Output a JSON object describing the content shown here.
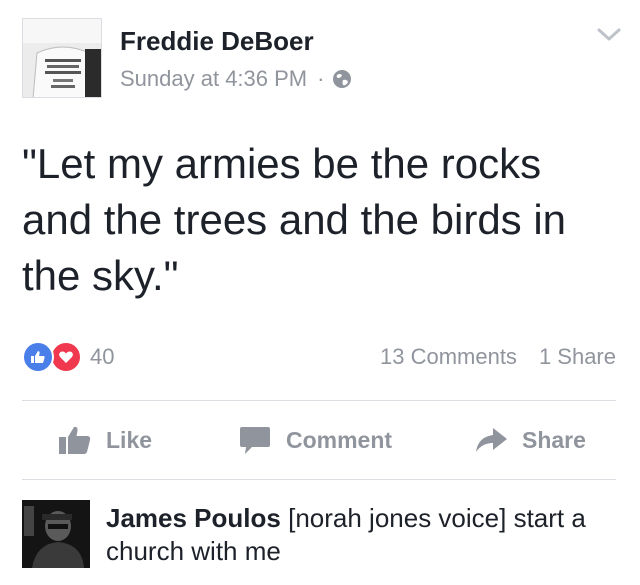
{
  "post": {
    "author": "Freddie DeBoer",
    "timestamp": "Sunday at 4:36 PM",
    "separator": "·",
    "privacy_icon": "globe-icon",
    "options_icon": "chevron-down-icon",
    "text": "\"Let my armies be the rocks and the trees and the birds in the sky.\""
  },
  "stats": {
    "reaction_icons": [
      "like-reaction-icon",
      "love-reaction-icon"
    ],
    "reaction_count": "40",
    "comments": "13 Comments",
    "shares": "1 Share"
  },
  "actions": {
    "like": "Like",
    "comment": "Comment",
    "share": "Share"
  },
  "comment": {
    "author": "James Poulos",
    "text": "[norah jones voice] start a church with me"
  },
  "colors": {
    "like_blue": "#4a7ee8",
    "love_red": "#f0394f",
    "secondary_gray": "#90949c",
    "divider": "#dadde1"
  }
}
